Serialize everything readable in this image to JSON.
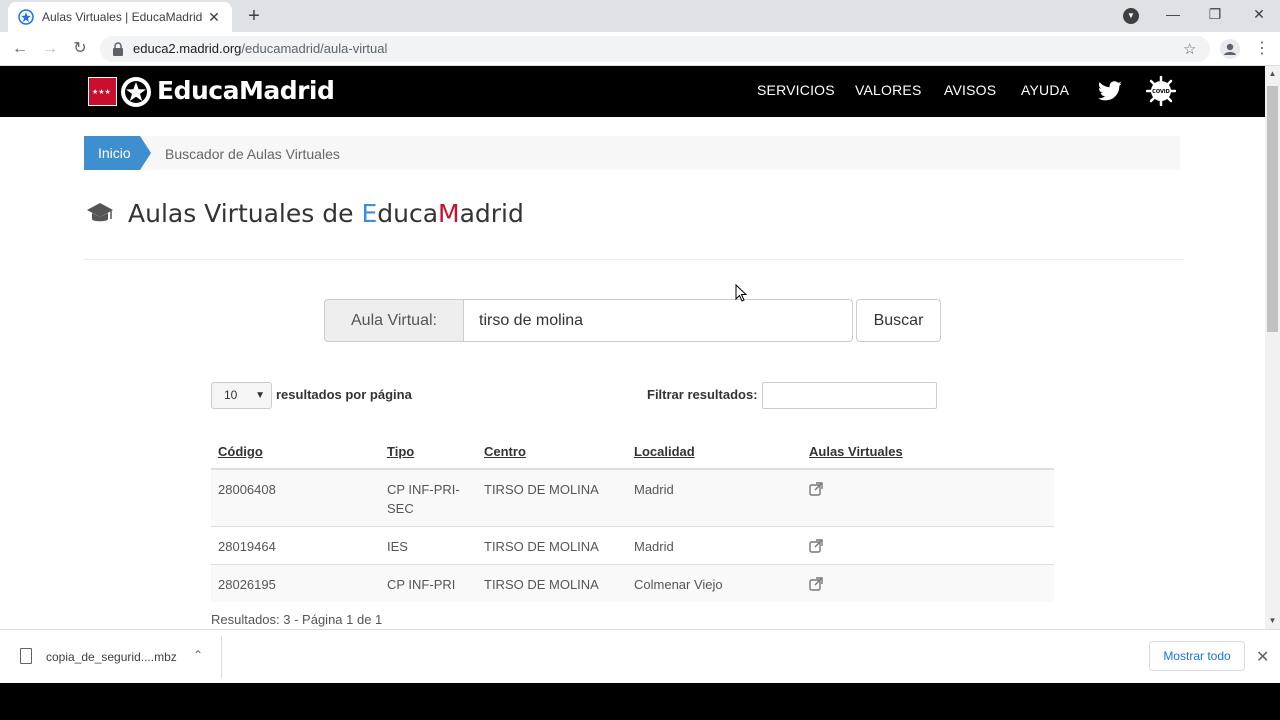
{
  "browser": {
    "tab_title": "Aulas Virtuales | EducaMadrid",
    "tab_close": "✕",
    "new_tab": "+",
    "url_host": "educa2.madrid.org",
    "url_path": "/educamadrid/aula-virtual"
  },
  "header": {
    "logo_text": "EducaMadrid",
    "nav": [
      "SERVICIOS",
      "VALORES",
      "AVISOS",
      "AYUDA"
    ],
    "covid_label": "COVID"
  },
  "breadcrumb": {
    "home": "Inicio",
    "current": "Buscador de Aulas Virtuales"
  },
  "heading": {
    "prefix": "Aulas Virtuales de ",
    "e": "E",
    "duca": "duca",
    "m": "M",
    "adrid": "adrid"
  },
  "search": {
    "label": "Aula Virtual:",
    "value": "tirso de molina",
    "button": "Buscar"
  },
  "table_controls": {
    "per_page_value": "10",
    "per_page_label": "resultados por página",
    "filter_label": "Filtrar resultados:"
  },
  "table": {
    "headers": [
      "Código",
      "Tipo",
      "Centro",
      "Localidad",
      "Aulas Virtuales"
    ],
    "rows": [
      {
        "codigo": "28006408",
        "tipo": "CP INF-PRI-SEC",
        "centro": "TIRSO DE MOLINA",
        "localidad": "Madrid"
      },
      {
        "codigo": "28019464",
        "tipo": "IES",
        "centro": "TIRSO DE MOLINA",
        "localidad": "Madrid"
      },
      {
        "codigo": "28026195",
        "tipo": "CP INF-PRI",
        "centro": "TIRSO DE MOLINA",
        "localidad": "Colmenar Viejo"
      }
    ]
  },
  "results_text": "Resultados: 3 - Página 1 de 1",
  "download_bar": {
    "file_name": "copia_de_segurid....mbz",
    "show_all": "Mostrar todo"
  },
  "colors": {
    "brand_blue": "#3d8fcf",
    "brand_red": "#c8102e",
    "header_bg": "#000000"
  }
}
